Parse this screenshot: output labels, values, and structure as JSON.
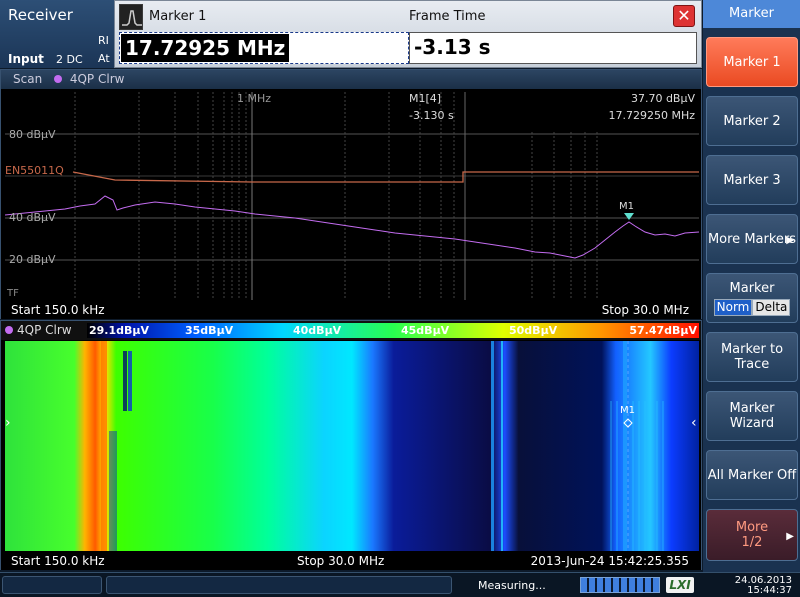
{
  "app": {
    "title": "Receiver",
    "rbw_fragment": "RI",
    "att_fragment": "At",
    "input_label": "Input",
    "input_detail": "2 DC"
  },
  "marker_dialog": {
    "title": "Marker 1",
    "column2_title": "Frame Time",
    "frequency_value": "17.72925 MHz",
    "time_value": "-3.13 s",
    "close_icon": "close-x"
  },
  "spectrum": {
    "mode": "Scan",
    "trace": "4QP Clrw",
    "trace_color": "#c36cf0",
    "ref_labels": [
      "80 dBµV",
      "40 dBµV",
      "20 dBµV"
    ],
    "limit_line": "EN55011Q",
    "limit_color": "#c7684a",
    "freq_marker": "1 MHz",
    "marker_name": "M1[4]",
    "marker_time": "-3.130 s",
    "marker_level": "37.70 dBµV",
    "marker_freq": "17.729250 MHz",
    "marker_label": "M1",
    "tf_label": "TF",
    "start": "Start 150.0 kHz",
    "stop": "Stop 30.0 MHz"
  },
  "spectrogram": {
    "trace": "4QP Clrw",
    "levels": [
      "29.1dBµV",
      "35dBµV",
      "40dBµV",
      "45dBµV",
      "50dBµV",
      "57.47dBµV"
    ],
    "marker_label": "M1",
    "start": "Start 150.0 kHz",
    "stop": "Stop 30.0 MHz",
    "timestamp": "2013-Jun-24 15:42:25.355"
  },
  "softkeys": {
    "title": "Marker",
    "marker1": "Marker 1",
    "marker2": "Marker 2",
    "marker3": "Marker 3",
    "more_markers": "More Markers",
    "marker_toggle_label": "Marker",
    "norm": "Norm",
    "delta": "Delta",
    "marker_to_trace": "Marker to Trace",
    "marker_wizard": "Marker Wizard",
    "all_marker_off": "All Marker Off",
    "more": "More",
    "more_page": "1/2"
  },
  "status": {
    "message": "Measuring...",
    "progress": 1.0,
    "lxi": "LXI",
    "date": "24.06.2013",
    "time": "15:44:37"
  }
}
